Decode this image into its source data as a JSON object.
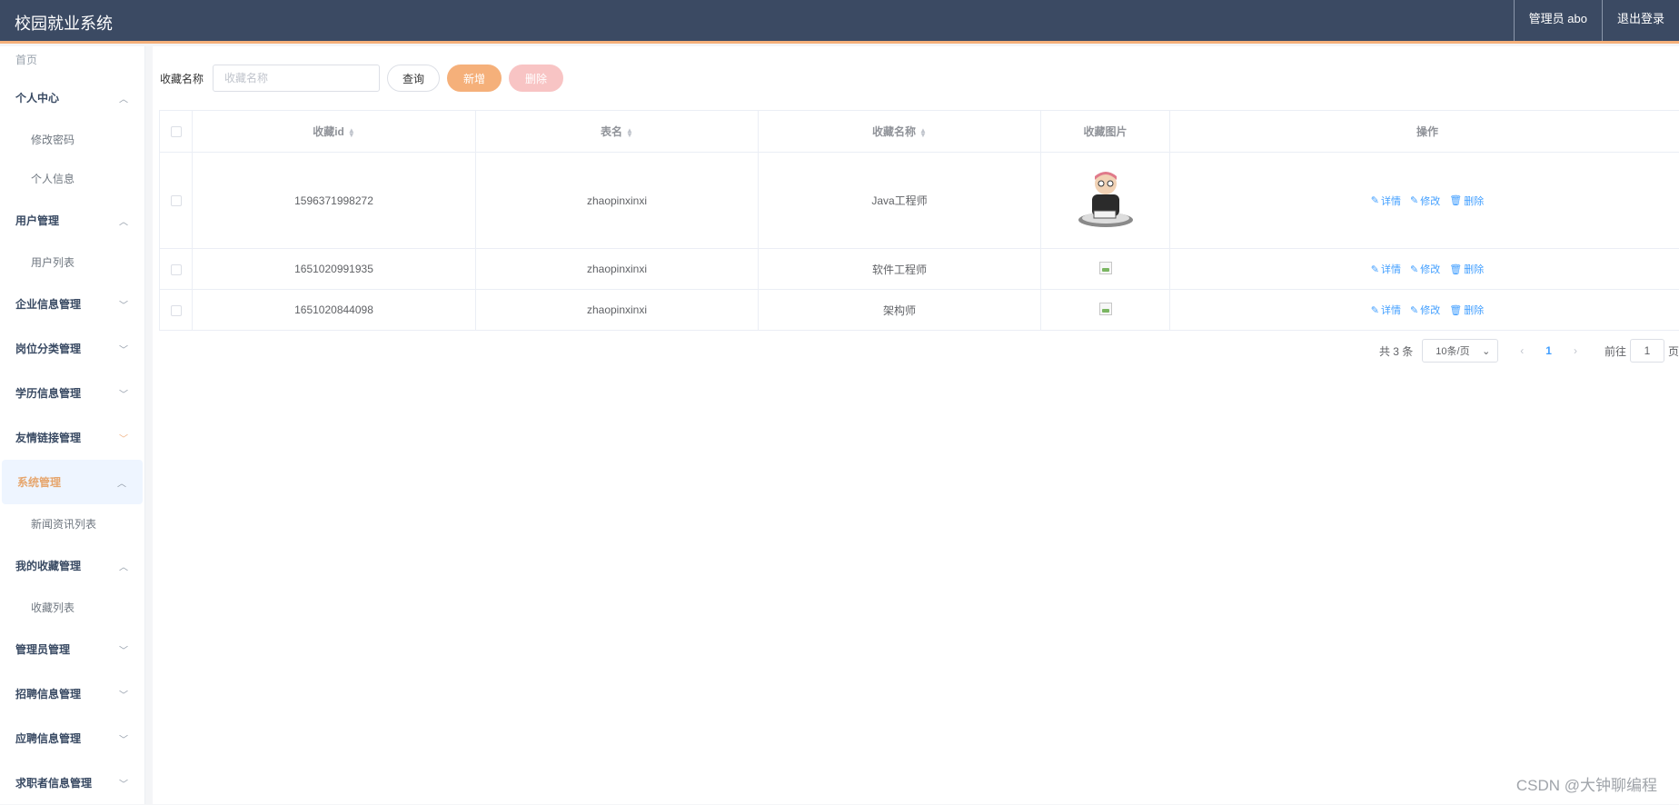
{
  "header": {
    "title": "校园就业系统",
    "user": "管理员 abo",
    "logout": "退出登录"
  },
  "sidebar": {
    "home": "首页",
    "menus": [
      {
        "label": "个人中心",
        "expanded": true,
        "children": [
          "修改密码",
          "个人信息"
        ]
      },
      {
        "label": "用户管理",
        "expanded": true,
        "children": [
          "用户列表"
        ]
      },
      {
        "label": "企业信息管理",
        "expanded": false,
        "children": []
      },
      {
        "label": "岗位分类管理",
        "expanded": false,
        "children": []
      },
      {
        "label": "学历信息管理",
        "expanded": false,
        "children": []
      },
      {
        "label": "友情链接管理",
        "expanded": false,
        "children": []
      },
      {
        "label": "系统管理",
        "expanded": true,
        "active": true,
        "children": [
          "新闻资讯列表"
        ]
      },
      {
        "label": "我的收藏管理",
        "expanded": true,
        "children": [
          "收藏列表"
        ]
      },
      {
        "label": "管理员管理",
        "expanded": false,
        "children": []
      },
      {
        "label": "招聘信息管理",
        "expanded": false,
        "children": []
      },
      {
        "label": "应聘信息管理",
        "expanded": false,
        "children": []
      },
      {
        "label": "求职者信息管理",
        "expanded": false,
        "children": []
      }
    ]
  },
  "search": {
    "label": "收藏名称",
    "placeholder": "收藏名称",
    "query": "查询",
    "add": "新增",
    "delete": "删除"
  },
  "table": {
    "headers": [
      "收藏id",
      "表名",
      "收藏名称",
      "收藏图片",
      "操作"
    ],
    "rows": [
      {
        "id": "1596371998272",
        "table": "zhaopinxinxi",
        "name": "Java工程师",
        "image": "cartoon-programmer"
      },
      {
        "id": "1651020991935",
        "table": "zhaopinxinxi",
        "name": "软件工程师",
        "image": "broken"
      },
      {
        "id": "1651020844098",
        "table": "zhaopinxinxi",
        "name": "架构师",
        "image": "broken"
      }
    ],
    "actions": {
      "detail": "详情",
      "edit": "修改",
      "delete": "删除"
    }
  },
  "pagination": {
    "total": "共 3 条",
    "page_size": "10条/页",
    "current": "1",
    "goto_label": "前往",
    "goto_value": "1",
    "goto_suffix": "页"
  },
  "watermark": "CSDN @大钟聊编程",
  "colors": {
    "header_bg": "#3b4a63",
    "accent_orange": "#f5b07a",
    "delete_pink": "#f8c4c4",
    "link_blue": "#409eff"
  }
}
